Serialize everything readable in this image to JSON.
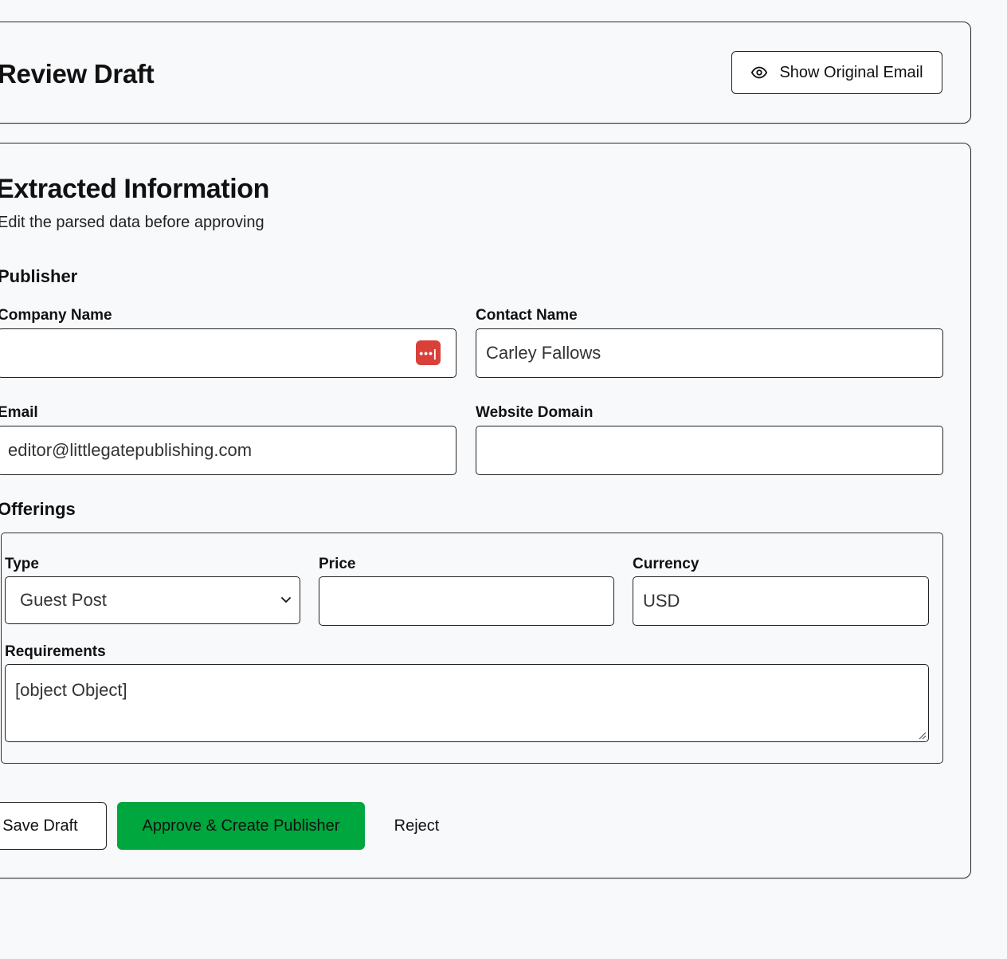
{
  "header": {
    "title": "Review Draft",
    "show_email_label": "Show Original Email"
  },
  "extracted": {
    "title": "Extracted Information",
    "subtitle": "Edit the parsed data before approving"
  },
  "publisher": {
    "heading": "Publisher",
    "company_name_label": "Company Name",
    "company_name_value": "",
    "contact_name_label": "Contact Name",
    "contact_name_value": "Carley Fallows",
    "email_label": "Email",
    "email_value": "editor@littlegatepublishing.com",
    "website_label": "Website Domain",
    "website_value": ""
  },
  "offerings": {
    "heading": "Offerings",
    "type_label": "Type",
    "type_value": "Guest Post",
    "price_label": "Price",
    "price_value": "",
    "currency_label": "Currency",
    "currency_value": "USD",
    "requirements_label": "Requirements",
    "requirements_value": "[object Object]"
  },
  "actions": {
    "save_label": "Save Draft",
    "approve_label": "Approve & Create Publisher",
    "reject_label": "Reject"
  },
  "icons": {
    "eye": "eye-icon",
    "password_manager": "password-manager-icon",
    "chevron": "chevron-down-icon",
    "resize": "resize-grip-icon"
  },
  "colors": {
    "primary": "#00a63e",
    "password_manager": "#d9403a",
    "background": "#f8f9fb"
  }
}
